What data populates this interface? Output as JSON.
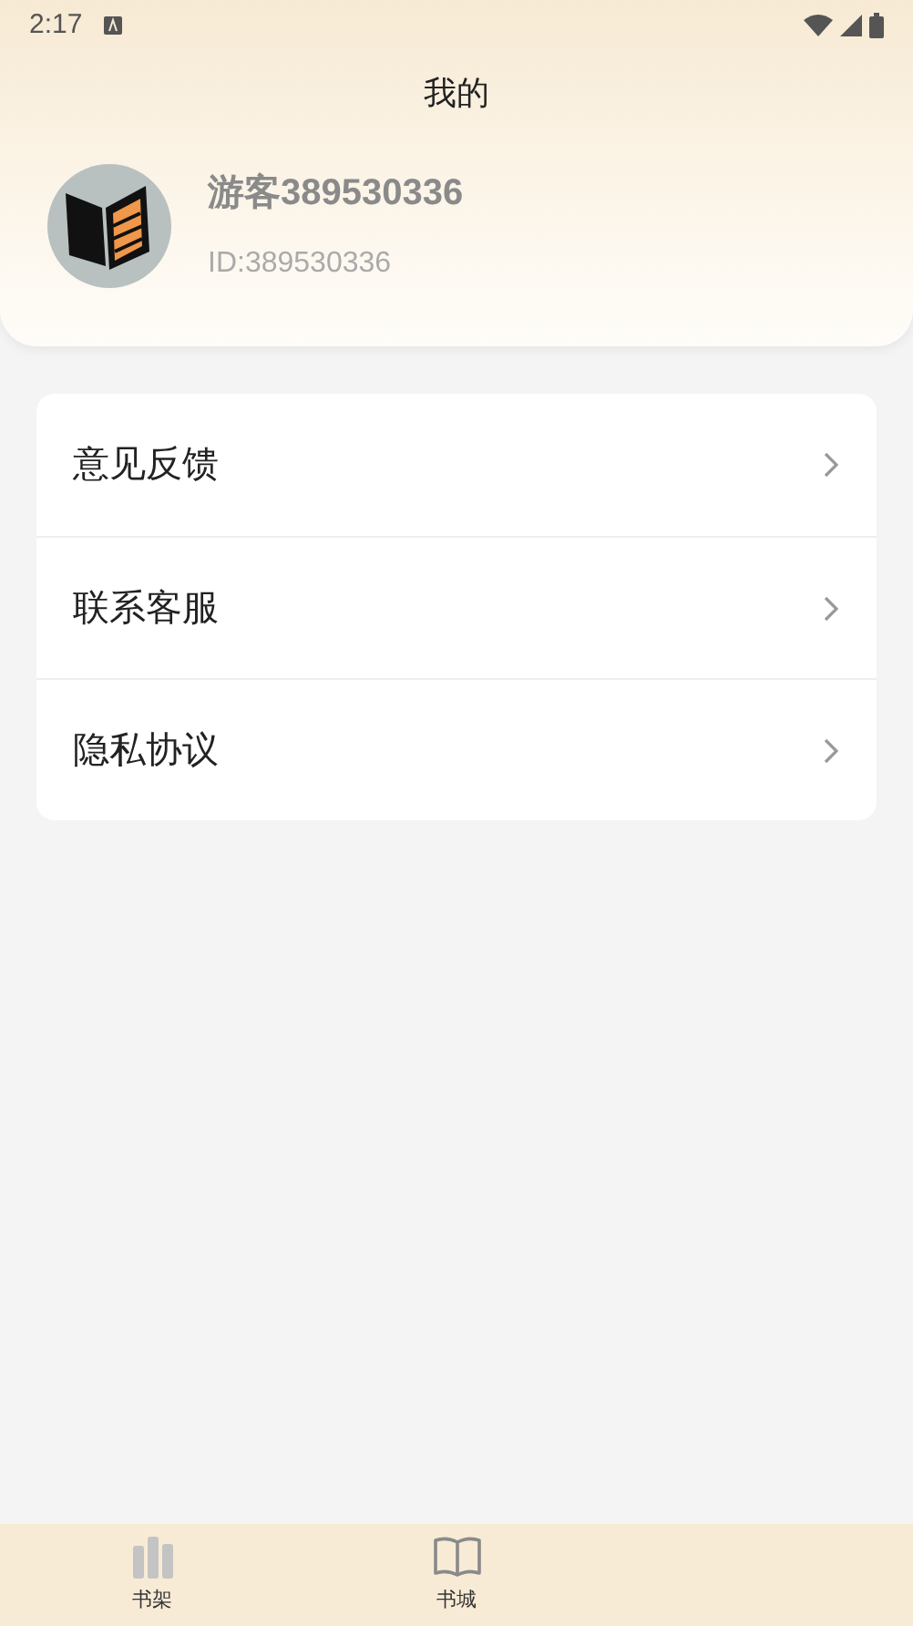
{
  "status_bar": {
    "time": "2:17"
  },
  "header": {
    "title": "我的"
  },
  "profile": {
    "name": "游客389530336",
    "id": "ID:389530336"
  },
  "menu": [
    {
      "label": "意见反馈"
    },
    {
      "label": "联系客服"
    },
    {
      "label": "隐私协议"
    }
  ],
  "tabs": [
    {
      "label": "书架",
      "kind": "shelf",
      "selected": false
    },
    {
      "label": "书城",
      "kind": "book",
      "selected": false
    }
  ]
}
